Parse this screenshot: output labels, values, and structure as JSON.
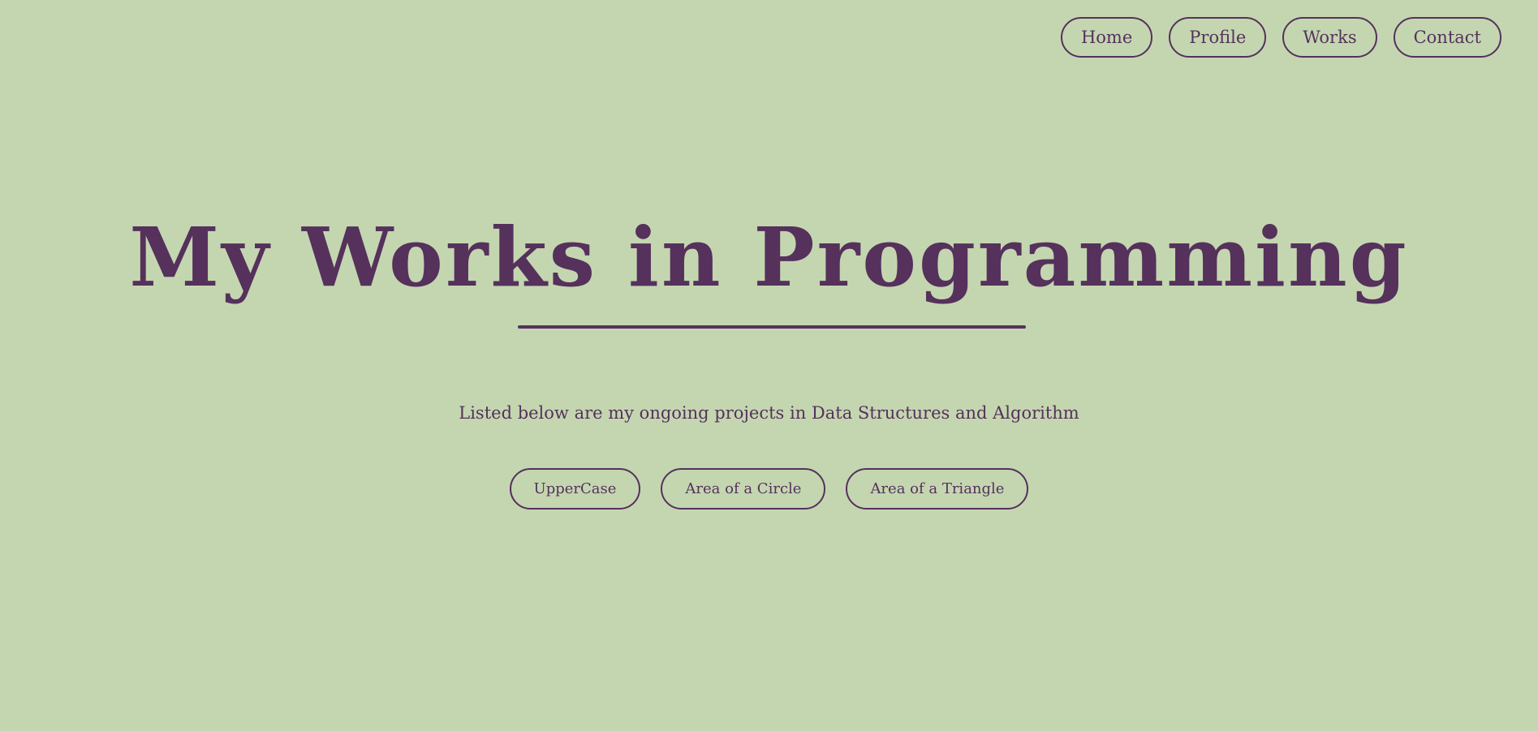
{
  "nav": {
    "items": [
      {
        "label": "Home"
      },
      {
        "label": "Profile"
      },
      {
        "label": "Works"
      },
      {
        "label": "Contact"
      }
    ]
  },
  "hero": {
    "title": "My Works in Programming",
    "subtitle": "Listed below are my ongoing projects in Data Structures and Algorithm"
  },
  "projects": [
    {
      "label": "UpperCase"
    },
    {
      "label": "Area of a Circle"
    },
    {
      "label": "Area of a Triangle"
    }
  ],
  "colors": {
    "background": "#c4d6b0",
    "accent": "#55315c"
  }
}
